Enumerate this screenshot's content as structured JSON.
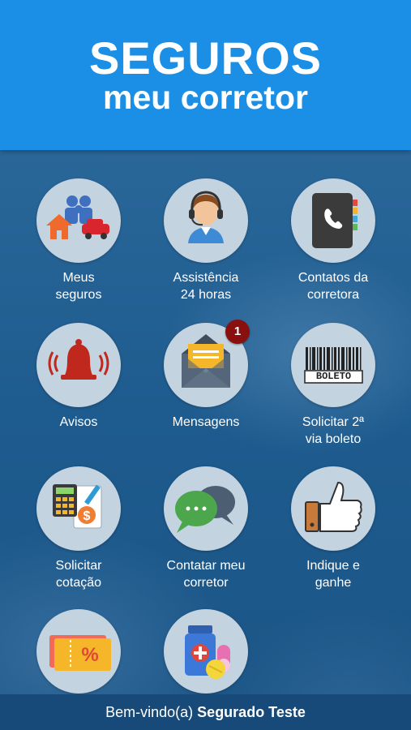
{
  "header": {
    "title_line1": "SEGUROS",
    "title_line2": "meu corretor"
  },
  "tiles": [
    {
      "label": "Meus\nseguros",
      "icon": "family-home-car-icon"
    },
    {
      "label": "Assistência\n24 horas",
      "icon": "headset-agent-icon"
    },
    {
      "label": "Contatos da\ncorretora",
      "icon": "phone-book-icon"
    },
    {
      "label": "Avisos",
      "icon": "alarm-bell-icon"
    },
    {
      "label": "Mensagens",
      "icon": "envelope-icon",
      "badge": "1"
    },
    {
      "label": "Solicitar 2ª\nvia boleto",
      "icon": "barcode-boleto-icon",
      "barcode_text": "BOLETO"
    },
    {
      "label": "Solicitar\ncotação",
      "icon": "calculator-document-icon"
    },
    {
      "label": "Contatar meu\ncorretor",
      "icon": "chat-bubbles-icon"
    },
    {
      "label": "Indique e\nganhe",
      "icon": "thumbs-up-icon"
    },
    {
      "label": "",
      "icon": "discount-ticket-icon"
    },
    {
      "label": "",
      "icon": "medicine-icon"
    }
  ],
  "footer": {
    "greeting": "Bem-vindo(a)",
    "user_name": "Segurado Teste"
  }
}
